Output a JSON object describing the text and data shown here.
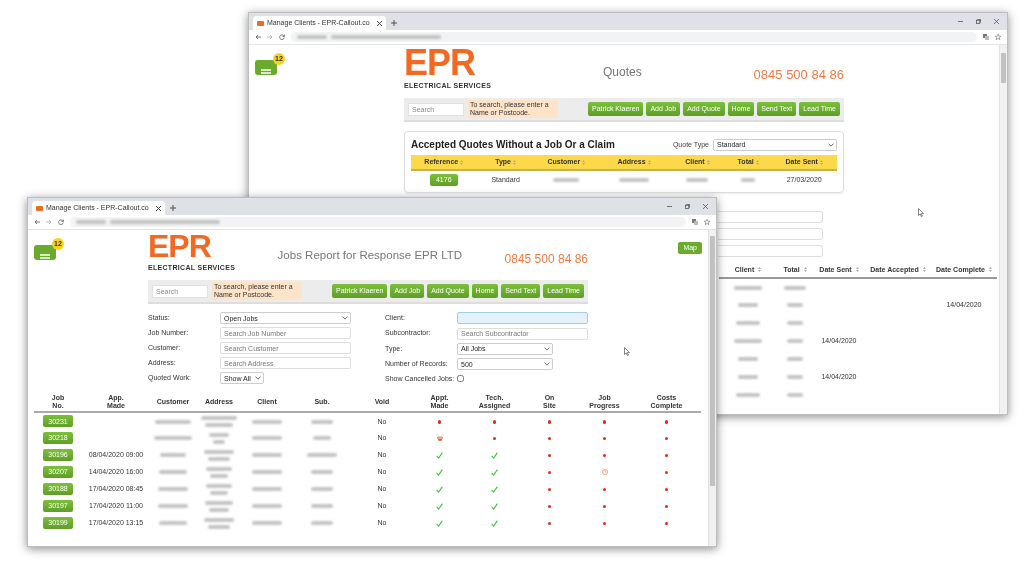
{
  "back_window": {
    "tab_title": "Manage Clients - EPR-Callout.co",
    "menu_badge": "12",
    "logo": {
      "mark": "EPR",
      "tagline": "ELECTRICAL SERVICES"
    },
    "page_title": "Quotes",
    "phone": "0845 500 84 86",
    "search": {
      "placeholder": "Search",
      "hint": "To search, please enter a Name or Postcode."
    },
    "nav_buttons": [
      "Patrick Klaeren",
      "Add Job",
      "Add Quote",
      "Home",
      "Send Text",
      "Lead Time"
    ],
    "quotes_card": {
      "title": "Accepted Quotes Without a Job Or a Claim",
      "filter_label": "Quote Type",
      "filter_value": "Standard",
      "columns": [
        "Reference",
        "Type",
        "Customer",
        "Address",
        "Client",
        "Total",
        "Date Sent"
      ],
      "rows": [
        {
          "reference": "4176",
          "type": "Standard",
          "date_sent": "27/03/2020"
        }
      ]
    },
    "quotes_table": {
      "columns": [
        "Client",
        "Total",
        "Date Sent",
        "Date Accepted",
        "Date Complete"
      ],
      "rows": [
        {},
        {
          "date_complete": "14/04/2020"
        },
        {},
        {
          "date_sent": "14/04/2020"
        },
        {},
        {
          "date_sent": "14/04/2020"
        },
        {}
      ]
    }
  },
  "front_window": {
    "tab_title": "Manage Clients - EPR-Callout.co",
    "menu_badge": "12",
    "map_button": "Map",
    "logo": {
      "mark": "EPR",
      "tagline": "ELECTRICAL SERVICES"
    },
    "page_title": "Jobs Report for Response EPR LTD",
    "phone": "0845 500 84 86",
    "search": {
      "placeholder": "Search",
      "hint": "To search, please enter a Name or Postcode."
    },
    "nav_buttons": [
      "Patrick Klaeren",
      "Add Job",
      "Add Quote",
      "Home",
      "Send Text",
      "Lead Time"
    ],
    "filters": {
      "left": [
        {
          "kind": "select",
          "label": "Status:",
          "value": "Open Jobs"
        },
        {
          "kind": "text",
          "label": "Job Number:",
          "placeholder": "Search Job Number"
        },
        {
          "kind": "text",
          "label": "Customer:",
          "placeholder": "Search Customer"
        },
        {
          "kind": "text",
          "label": "Address:",
          "placeholder": "Search Address"
        },
        {
          "kind": "short_select",
          "label": "Quoted Work:",
          "value": "Show All"
        }
      ],
      "right": [
        {
          "kind": "text",
          "label": "Client:",
          "highlighted": true
        },
        {
          "kind": "text",
          "label": "Subcontractor:",
          "placeholder": "Search Subcontractor"
        },
        {
          "kind": "select",
          "label": "Type:",
          "value": "All Jobs"
        },
        {
          "kind": "select",
          "label": "Number of Records:",
          "value": "500"
        },
        {
          "kind": "checkbox",
          "label": "Show Cancelled Jobs:",
          "checked": false
        }
      ]
    },
    "jobs_table": {
      "columns": [
        "Job No.",
        "App. Made",
        "Customer",
        "Address",
        "Client",
        "Sub.",
        "Void",
        "Appt. Made",
        "Tech. Assigned",
        "On Site",
        "Job Progress",
        "Costs Complete"
      ],
      "rows": [
        {
          "job": "30231",
          "void": "No",
          "stages": [
            {
              "kind": "dot"
            },
            {
              "kind": "dot"
            },
            {
              "kind": "dot"
            },
            {
              "kind": "dot"
            },
            {
              "kind": "dot"
            }
          ]
        },
        {
          "job": "30218",
          "void": "No",
          "stages": [
            {
              "kind": "phone"
            },
            {
              "kind": "dot"
            },
            {
              "kind": "dot"
            },
            {
              "kind": "dot"
            },
            {
              "kind": "dot"
            }
          ]
        },
        {
          "job": "30196",
          "appointment": "08/04/2020 09:00",
          "void": "No",
          "stages": [
            {
              "kind": "check"
            },
            {
              "kind": "check"
            },
            {
              "kind": "dot"
            },
            {
              "kind": "dot"
            },
            {
              "kind": "dot"
            }
          ]
        },
        {
          "job": "30207",
          "appointment": "14/04/2020 16:00",
          "void": "No",
          "stages": [
            {
              "kind": "check"
            },
            {
              "kind": "check"
            },
            {
              "kind": "dot"
            },
            {
              "kind": "clock"
            },
            {
              "kind": "dot"
            }
          ]
        },
        {
          "job": "30188",
          "appointment": "17/04/2020 08:45",
          "void": "No",
          "stages": [
            {
              "kind": "check"
            },
            {
              "kind": "check"
            },
            {
              "kind": "dot"
            },
            {
              "kind": "dot"
            },
            {
              "kind": "dot"
            }
          ]
        },
        {
          "job": "30197",
          "appointment": "17/04/2020 11:00",
          "void": "No",
          "stages": [
            {
              "kind": "check"
            },
            {
              "kind": "check"
            },
            {
              "kind": "dot"
            },
            {
              "kind": "dot"
            },
            {
              "kind": "dot"
            }
          ]
        },
        {
          "job": "30199",
          "appointment": "17/04/2020 13:15",
          "void": "No",
          "stages": [
            {
              "kind": "check"
            },
            {
              "kind": "check"
            },
            {
              "kind": "dot"
            },
            {
              "kind": "dot"
            },
            {
              "kind": "dot"
            }
          ]
        }
      ]
    }
  }
}
